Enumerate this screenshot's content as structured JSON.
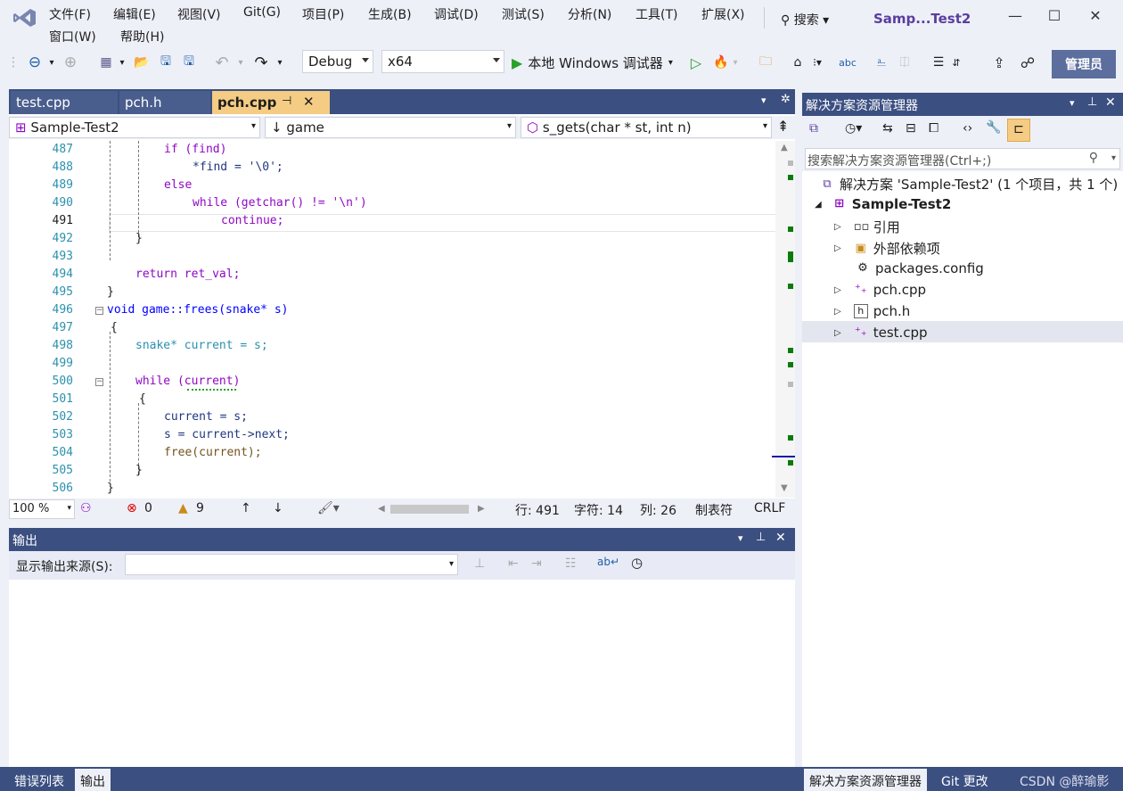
{
  "menu": {
    "row1": [
      "文件(F)",
      "编辑(E)",
      "视图(V)",
      "Git(G)",
      "项目(P)",
      "生成(B)",
      "调试(D)",
      "测试(S)",
      "分析(N)",
      "工具(T)",
      "扩展(X)"
    ],
    "row2": [
      "窗口(W)",
      "帮助(H)"
    ]
  },
  "search_label": "搜索",
  "window_title": "Samp...Test2",
  "toolbar": {
    "config": "Debug",
    "platform": "x64",
    "run_label": "本地 Windows 调试器",
    "admin": "管理员"
  },
  "tabs": [
    {
      "label": "test.cpp"
    },
    {
      "label": "pch.h"
    },
    {
      "label": "pch.cpp"
    }
  ],
  "nav": {
    "project": "Sample-Test2",
    "scope": "game",
    "member": "s_gets(char * st, int n)"
  },
  "line_numbers": [
    "487",
    "488",
    "489",
    "490",
    "491",
    "492",
    "493",
    "494",
    "495",
    "496",
    "497",
    "498",
    "499",
    "500",
    "501",
    "502",
    "503",
    "504",
    "505",
    "506"
  ],
  "code": {
    "l487": "if (find)",
    "l488": "*find = '\\0';",
    "l489": "else",
    "l490": "while (getchar() != '\\n')",
    "l491": "continue;",
    "l492": "}",
    "l494": "return ret_val;",
    "l495": "}",
    "l496": "void game::frees(snake* s)",
    "l497": "{",
    "l498": "snake* current = s;",
    "l500": "while (current)",
    "l501": "{",
    "l502": "current = s;",
    "l503": "s = current->next;",
    "l504": "free(current);",
    "l505": "}",
    "l506": "}"
  },
  "status": {
    "zoom": "100 %",
    "errors": "0",
    "warnings": "9",
    "line": "行: 491",
    "char": "字符: 14",
    "col": "列: 26",
    "tabs": "制表符",
    "eol": "CRLF"
  },
  "output": {
    "title": "输出",
    "source_label": "显示输出来源(S):"
  },
  "solution_explorer": {
    "title": "解决方案资源管理器",
    "search_placeholder": "搜索解决方案资源管理器(Ctrl+;)",
    "solution": "解决方案 'Sample-Test2' (1 个项目，共 1 个)",
    "project": "Sample-Test2",
    "items": [
      "引用",
      "外部依赖项",
      "packages.config",
      "pch.cpp",
      "pch.h",
      "test.cpp"
    ]
  },
  "bottom_tabs": {
    "left": [
      "错误列表",
      "输出"
    ],
    "right": [
      "解决方案资源管理器",
      "Git 更改"
    ]
  },
  "watermark": "CSDN @醉瑜影",
  "colors": {
    "accent": "#3b4f81",
    "active_tab": "#f5cc84",
    "run_green": "#2aa12a"
  }
}
